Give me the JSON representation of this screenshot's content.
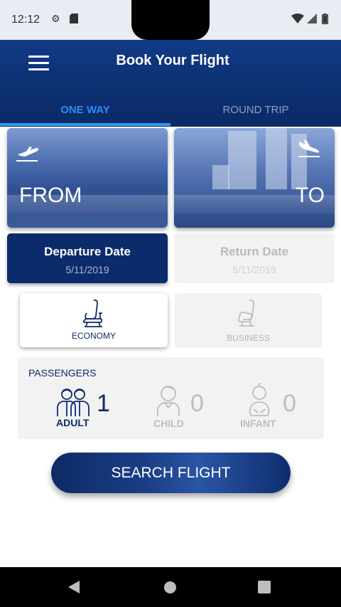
{
  "status_bar": {
    "time": "12:12"
  },
  "header": {
    "title": "Book Your Flight"
  },
  "tabs": {
    "one_way": "ONE WAY",
    "round_trip": "ROUND TRIP"
  },
  "cities": {
    "from_label": "FROM",
    "to_label": "TO"
  },
  "dates": {
    "departure": {
      "title": "Departure Date",
      "value": "5/11/2019"
    },
    "return": {
      "title": "Return Date",
      "value": "5/11/2019"
    }
  },
  "travel_class": {
    "economy": "ECONOMY",
    "business": "BUSINESS"
  },
  "passengers": {
    "title": "PASSENGERS",
    "adult": {
      "label": "ADULT",
      "count": "1"
    },
    "child": {
      "label": "CHILD",
      "count": "0"
    },
    "infant": {
      "label": "INFANT",
      "count": "0"
    }
  },
  "search_button": "SEARCH FLIGHT",
  "colors": {
    "primary": "#0c2b6b",
    "accent": "#2d8cf0",
    "disabled": "#b9b9b9"
  }
}
